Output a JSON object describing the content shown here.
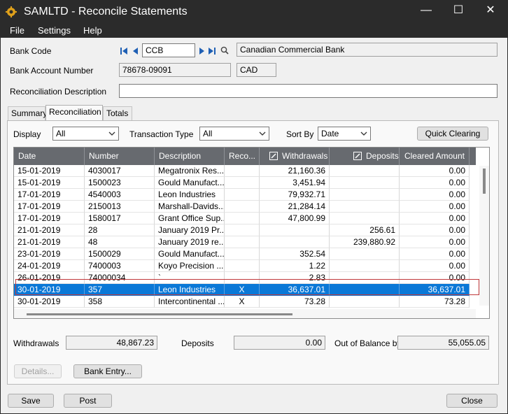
{
  "window": {
    "title": "SAMLTD - Reconcile Statements"
  },
  "menu": [
    "File",
    "Settings",
    "Help"
  ],
  "header": {
    "bank_code_label": "Bank Code",
    "bank_code": "CCB",
    "bank_name": "Canadian Commercial Bank",
    "account_label": "Bank Account Number",
    "account_number": "78678-09091",
    "currency": "CAD",
    "description_label": "Reconciliation Description",
    "description": ""
  },
  "tabs": [
    "Summary",
    "Reconciliation",
    "Totals"
  ],
  "filters": {
    "display_label": "Display",
    "display_value": "All",
    "transaction_type_label": "Transaction Type",
    "transaction_type_value": "All",
    "sort_by_label": "Sort By",
    "sort_by_value": "Date",
    "quick_clearing_label": "Quick Clearing"
  },
  "table": {
    "columns": [
      "Date",
      "Number",
      "Description",
      "Reco...",
      "Withdrawals",
      "Deposits",
      "Cleared Amount"
    ],
    "rows": [
      [
        "15-01-2019",
        "4030017",
        "Megatronix Res...",
        "",
        "21,160.36",
        "",
        "0.00"
      ],
      [
        "15-01-2019",
        "1500023",
        "Gould Manufact...",
        "",
        "3,451.94",
        "",
        "0.00"
      ],
      [
        "17-01-2019",
        "4540003",
        "Leon Industries",
        "",
        "79,932.71",
        "",
        "0.00"
      ],
      [
        "17-01-2019",
        "2150013",
        "Marshall-Davids...",
        "",
        "21,284.14",
        "",
        "0.00"
      ],
      [
        "17-01-2019",
        "1580017",
        "Grant Office Sup...",
        "",
        "47,800.99",
        "",
        "0.00"
      ],
      [
        "21-01-2019",
        "28",
        "January 2019 Pr...",
        "",
        "",
        "256.61",
        "0.00"
      ],
      [
        "21-01-2019",
        "48",
        "January 2019 re...",
        "",
        "",
        "239,880.92",
        "0.00"
      ],
      [
        "23-01-2019",
        "1500029",
        "Gould Manufact...",
        "",
        "352.54",
        "",
        "0.00"
      ],
      [
        "24-01-2019",
        "7400003",
        "Koyo Precision ...",
        "",
        "1.22",
        "",
        "0.00"
      ],
      [
        "26-01-2019",
        "74000034",
        "`",
        "",
        "2.83",
        "",
        "0.00"
      ],
      [
        "30-01-2019",
        "357",
        "Leon Industries",
        "X",
        "36,637.01",
        "",
        "36,637.01"
      ],
      [
        "30-01-2019",
        "358",
        "Intercontinental ...",
        "X",
        "73.28",
        "",
        "73.28"
      ]
    ],
    "selected_index": 10
  },
  "totals": {
    "withdrawals_label": "Withdrawals",
    "withdrawals": "48,867.23",
    "deposits_label": "Deposits",
    "deposits": "0.00",
    "out_of_balance_label": "Out of Balance by",
    "out_of_balance": "55,055.05"
  },
  "buttons": {
    "details": "Details...",
    "bank_entry": "Bank Entry...",
    "save": "Save",
    "post": "Post",
    "close": "Close"
  },
  "colors": {
    "selection": "#0a78d7",
    "titlebar": "#2b2b2b",
    "highlight_box": "#c0393b"
  }
}
